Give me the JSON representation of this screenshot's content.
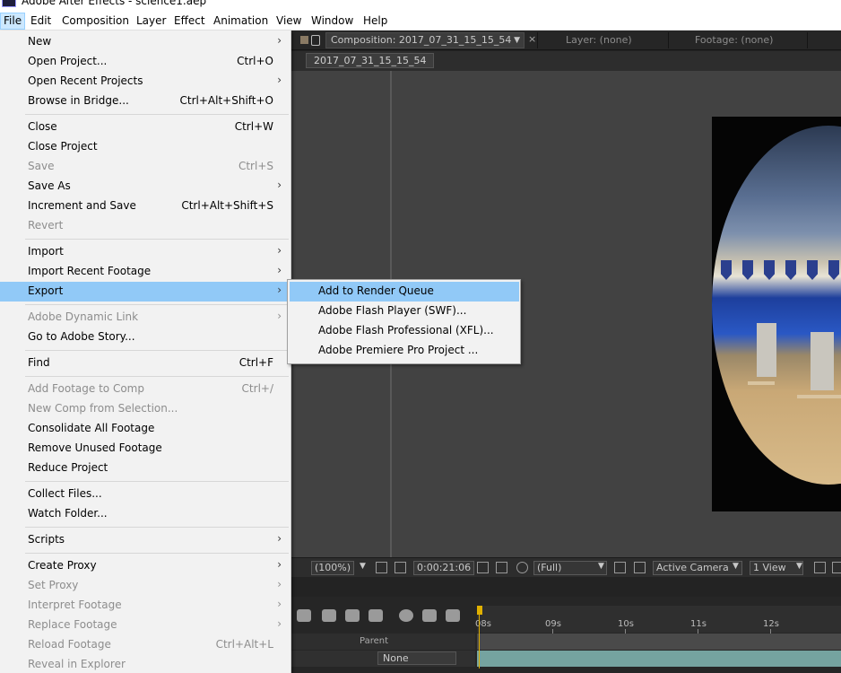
{
  "window": {
    "title": "Adobe After Effects - science1.aep"
  },
  "menubar": [
    "File",
    "Edit",
    "Composition",
    "Layer",
    "Effect",
    "Animation",
    "View",
    "Window",
    "Help"
  ],
  "file_menu": [
    {
      "label": "New",
      "shortcut": "",
      "submenu": true,
      "disabled": false,
      "highlight": false
    },
    {
      "label": "Open Project...",
      "shortcut": "Ctrl+O",
      "submenu": false,
      "disabled": false,
      "highlight": false
    },
    {
      "label": "Open Recent Projects",
      "shortcut": "",
      "submenu": true,
      "disabled": false,
      "highlight": false
    },
    {
      "label": "Browse in Bridge...",
      "shortcut": "Ctrl+Alt+Shift+O",
      "submenu": false,
      "disabled": false,
      "highlight": false
    },
    {
      "separator": true
    },
    {
      "label": "Close",
      "shortcut": "Ctrl+W",
      "submenu": false,
      "disabled": false,
      "highlight": false
    },
    {
      "label": "Close Project",
      "shortcut": "",
      "submenu": false,
      "disabled": false,
      "highlight": false
    },
    {
      "label": "Save",
      "shortcut": "Ctrl+S",
      "submenu": false,
      "disabled": true,
      "highlight": false
    },
    {
      "label": "Save As",
      "shortcut": "",
      "submenu": true,
      "disabled": false,
      "highlight": false
    },
    {
      "label": "Increment and Save",
      "shortcut": "Ctrl+Alt+Shift+S",
      "submenu": false,
      "disabled": false,
      "highlight": false
    },
    {
      "label": "Revert",
      "shortcut": "",
      "submenu": false,
      "disabled": true,
      "highlight": false
    },
    {
      "separator": true
    },
    {
      "label": "Import",
      "shortcut": "",
      "submenu": true,
      "disabled": false,
      "highlight": false
    },
    {
      "label": "Import Recent Footage",
      "shortcut": "",
      "submenu": true,
      "disabled": false,
      "highlight": false
    },
    {
      "label": "Export",
      "shortcut": "",
      "submenu": true,
      "disabled": false,
      "highlight": true
    },
    {
      "separator": true
    },
    {
      "label": "Adobe Dynamic Link",
      "shortcut": "",
      "submenu": true,
      "disabled": true,
      "highlight": false
    },
    {
      "label": "Go to Adobe Story...",
      "shortcut": "",
      "submenu": false,
      "disabled": false,
      "highlight": false
    },
    {
      "separator": true
    },
    {
      "label": "Find",
      "shortcut": "Ctrl+F",
      "submenu": false,
      "disabled": false,
      "highlight": false
    },
    {
      "separator": true
    },
    {
      "label": "Add Footage to Comp",
      "shortcut": "Ctrl+/",
      "submenu": false,
      "disabled": true,
      "highlight": false
    },
    {
      "label": "New Comp from Selection...",
      "shortcut": "",
      "submenu": false,
      "disabled": true,
      "highlight": false
    },
    {
      "label": "Consolidate All Footage",
      "shortcut": "",
      "submenu": false,
      "disabled": false,
      "highlight": false
    },
    {
      "label": "Remove Unused Footage",
      "shortcut": "",
      "submenu": false,
      "disabled": false,
      "highlight": false
    },
    {
      "label": "Reduce Project",
      "shortcut": "",
      "submenu": false,
      "disabled": false,
      "highlight": false
    },
    {
      "separator": true
    },
    {
      "label": "Collect Files...",
      "shortcut": "",
      "submenu": false,
      "disabled": false,
      "highlight": false
    },
    {
      "label": "Watch Folder...",
      "shortcut": "",
      "submenu": false,
      "disabled": false,
      "highlight": false
    },
    {
      "separator": true
    },
    {
      "label": "Scripts",
      "shortcut": "",
      "submenu": true,
      "disabled": false,
      "highlight": false
    },
    {
      "separator": true
    },
    {
      "label": "Create Proxy",
      "shortcut": "",
      "submenu": true,
      "disabled": false,
      "highlight": false
    },
    {
      "label": "Set Proxy",
      "shortcut": "",
      "submenu": true,
      "disabled": true,
      "highlight": false
    },
    {
      "label": "Interpret Footage",
      "shortcut": "",
      "submenu": true,
      "disabled": true,
      "highlight": false
    },
    {
      "label": "Replace Footage",
      "shortcut": "",
      "submenu": true,
      "disabled": true,
      "highlight": false
    },
    {
      "label": "Reload Footage",
      "shortcut": "Ctrl+Alt+L",
      "submenu": false,
      "disabled": true,
      "highlight": false
    },
    {
      "label": "Reveal in Explorer",
      "shortcut": "",
      "submenu": false,
      "disabled": true,
      "highlight": false
    }
  ],
  "export_submenu": [
    {
      "label": "Add to Render Queue",
      "highlight": true
    },
    {
      "label": "Adobe Flash Player (SWF)...",
      "highlight": false
    },
    {
      "label": "Adobe Flash Professional (XFL)...",
      "highlight": false
    },
    {
      "label": "Adobe Premiere Pro Project ...",
      "highlight": false
    }
  ],
  "panels": {
    "composition_tab": "Composition: 2017_07_31_15_15_54",
    "layer_tab": "Layer: (none)",
    "footage_tab": "Footage: (none)",
    "comp_name": "2017_07_31_15_15_54",
    "close_glyph": "×"
  },
  "viewer_toolbar": {
    "zoom": "(100%)",
    "timecode": "0:00:21:06",
    "resolution": "(Full)",
    "camera": "Active Camera",
    "views": "1 View"
  },
  "timeline": {
    "ticks": [
      "08s",
      "09s",
      "10s",
      "11s",
      "12s"
    ],
    "parent_header": "Parent",
    "parent_value": "None"
  },
  "colors": {
    "menu_highlight": "#91c9f7",
    "menubar_active": "#cce8ff",
    "ae_panel": "#424242",
    "playhead": "#e0b000",
    "layer_bar": "#75a3a0"
  }
}
